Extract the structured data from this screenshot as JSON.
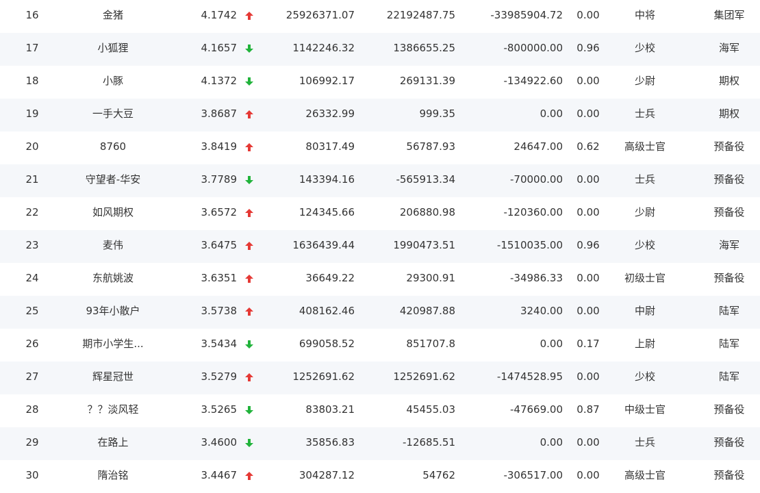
{
  "colors": {
    "up": "#e53935",
    "down": "#21b33b"
  },
  "rows": [
    {
      "rank": "16",
      "name": "金猪",
      "score": "4.1742",
      "trend": "up",
      "v1": "25926371.07",
      "v2": "22192487.75",
      "v3": "-33985904.72",
      "ratio": "0.00",
      "rank_name": "中将",
      "group": "集团军"
    },
    {
      "rank": "17",
      "name": "小狐狸",
      "score": "4.1657",
      "trend": "down",
      "v1": "1142246.32",
      "v2": "1386655.25",
      "v3": "-800000.00",
      "ratio": "0.96",
      "rank_name": "少校",
      "group": "海军"
    },
    {
      "rank": "18",
      "name": "小豚",
      "score": "4.1372",
      "trend": "down",
      "v1": "106992.17",
      "v2": "269131.39",
      "v3": "-134922.60",
      "ratio": "0.00",
      "rank_name": "少尉",
      "group": "期权"
    },
    {
      "rank": "19",
      "name": "一手大豆",
      "score": "3.8687",
      "trend": "up",
      "v1": "26332.99",
      "v2": "999.35",
      "v3": "0.00",
      "ratio": "0.00",
      "rank_name": "士兵",
      "group": "期权"
    },
    {
      "rank": "20",
      "name": "8760",
      "score": "3.8419",
      "trend": "up",
      "v1": "80317.49",
      "v2": "56787.93",
      "v3": "24647.00",
      "ratio": "0.62",
      "rank_name": "高级士官",
      "group": "预备役"
    },
    {
      "rank": "21",
      "name": "守望者-华安",
      "score": "3.7789",
      "trend": "down",
      "v1": "143394.16",
      "v2": "-565913.34",
      "v3": "-70000.00",
      "ratio": "0.00",
      "rank_name": "士兵",
      "group": "预备役"
    },
    {
      "rank": "22",
      "name": "如风期权",
      "score": "3.6572",
      "trend": "up",
      "v1": "124345.66",
      "v2": "206880.98",
      "v3": "-120360.00",
      "ratio": "0.00",
      "rank_name": "少尉",
      "group": "预备役"
    },
    {
      "rank": "23",
      "name": "麦伟",
      "score": "3.6475",
      "trend": "up",
      "v1": "1636439.44",
      "v2": "1990473.51",
      "v3": "-1510035.00",
      "ratio": "0.96",
      "rank_name": "少校",
      "group": "海军"
    },
    {
      "rank": "24",
      "name": "东航姚波",
      "score": "3.6351",
      "trend": "up",
      "v1": "36649.22",
      "v2": "29300.91",
      "v3": "-34986.33",
      "ratio": "0.00",
      "rank_name": "初级士官",
      "group": "预备役"
    },
    {
      "rank": "25",
      "name": "93年小散户",
      "score": "3.5738",
      "trend": "up",
      "v1": "408162.46",
      "v2": "420987.88",
      "v3": "3240.00",
      "ratio": "0.00",
      "rank_name": "中尉",
      "group": "陆军"
    },
    {
      "rank": "26",
      "name": "期市小学生...",
      "score": "3.5434",
      "trend": "down",
      "v1": "699058.52",
      "v2": "851707.8",
      "v3": "0.00",
      "ratio": "0.17",
      "rank_name": "上尉",
      "group": "陆军"
    },
    {
      "rank": "27",
      "name": "辉星冠世",
      "score": "3.5279",
      "trend": "up",
      "v1": "1252691.62",
      "v2": "1252691.62",
      "v3": "-1474528.95",
      "ratio": "0.00",
      "rank_name": "少校",
      "group": "陆军"
    },
    {
      "rank": "28",
      "name": "？？淡风轻",
      "score": "3.5265",
      "trend": "down",
      "v1": "83803.21",
      "v2": "45455.03",
      "v3": "-47669.00",
      "ratio": "0.87",
      "rank_name": "中级士官",
      "group": "预备役"
    },
    {
      "rank": "29",
      "name": "在路上",
      "score": "3.4600",
      "trend": "down",
      "v1": "35856.83",
      "v2": "-12685.51",
      "v3": "0.00",
      "ratio": "0.00",
      "rank_name": "士兵",
      "group": "预备役"
    },
    {
      "rank": "30",
      "name": "隋治铭",
      "score": "3.4467",
      "trend": "up",
      "v1": "304287.12",
      "v2": "54762",
      "v3": "-306517.00",
      "ratio": "0.00",
      "rank_name": "高级士官",
      "group": "预备役"
    }
  ]
}
